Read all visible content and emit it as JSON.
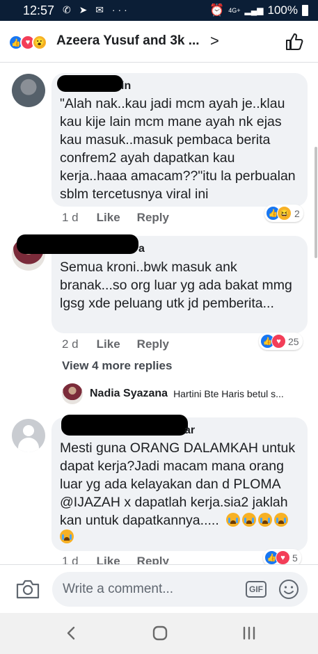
{
  "status_bar": {
    "time": "12:57",
    "left_icons": "✆ ➤ ✉ ···",
    "network": "4G+",
    "battery": "100%"
  },
  "header": {
    "title": "Azeera Yusuf and 3k ...",
    "reactions": [
      "like-icon",
      "love-icon",
      "wow-icon"
    ]
  },
  "comments": [
    {
      "name_visible": "in",
      "text": "\"Alah nak..kau jadi mcm ayah je..klau kau kije lain mcm mane ayah nk ejas kau masuk..masuk pembaca berita confrem2 ayah dapatkan kau kerja..haaa amacam??\"itu la perbualan sblm tercetusnya viral ini",
      "time": "1 d",
      "like_label": "Like",
      "reply_label": "Reply",
      "reaction_count": "2"
    },
    {
      "name_visible": "a",
      "text": "Semua kroni..bwk masuk ank branak...so org luar yg ada bakat mmg lgsg xde peluang utk jd pemberita...",
      "time": "2 d",
      "like_label": "Like",
      "reply_label": "Reply",
      "reaction_count": "25"
    },
    {
      "name_visible": "ar",
      "text": "Mesti guna ORANG DALAMKAH untuk dapat kerja?Jadi macam mana orang luar yg ada kelayakan dan d PLOMA @IJAZAH x dapatlah kerja.sia2 jaklah kan untuk dapatkannya.....",
      "time": "1 d",
      "like_label": "Like",
      "reply_label": "Reply",
      "reaction_count": "5"
    }
  ],
  "view_more": "View 4 more replies",
  "reply_preview": {
    "name": "Nadia Syazana",
    "text": "Hartini Bte Haris betul s..."
  },
  "composer": {
    "placeholder": "Write a comment...",
    "gif_label": "GIF"
  },
  "colors": {
    "status_bar": "#0b1e36",
    "bubble": "#f0f2f5",
    "like_blue": "#1877f2",
    "love_red": "#f33e58"
  }
}
